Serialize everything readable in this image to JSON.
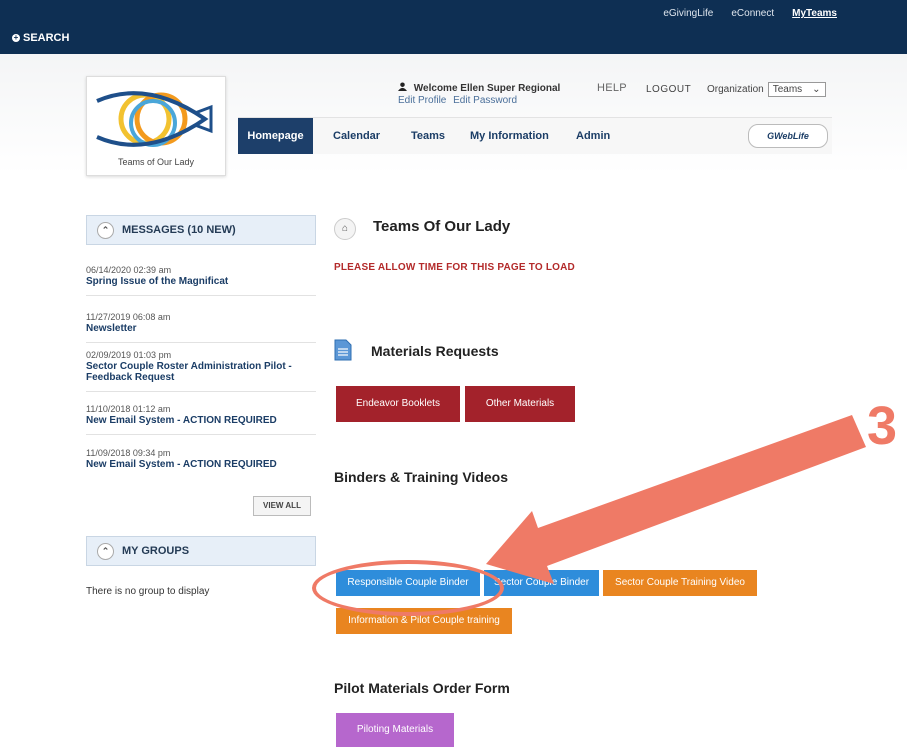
{
  "top_links": [
    "eGivingLife",
    "eConnect",
    "MyTeams"
  ],
  "search_label": "SEARCH",
  "logo_text": "Teams of Our Lady",
  "welcome": "Welcome Ellen Super Regional",
  "edit_profile": "Edit Profile",
  "edit_password": "Edit Password",
  "help": "HELP",
  "logout": "LOGOUT",
  "org_label": "Organization",
  "org_value": "Teams",
  "nav": [
    "Homepage",
    "Calendar",
    "Teams",
    "My Information",
    "Admin"
  ],
  "gweblife": "GWebLife",
  "messages_header": "MESSAGES (10 NEW)",
  "messages": [
    {
      "date": "06/14/2020 02:39 am",
      "title": "Spring Issue of the Magnificat"
    },
    {
      "date": "11/27/2019 06:08 am",
      "title": "Newsletter"
    },
    {
      "date": "02/09/2019 01:03 pm",
      "title": "Sector Couple Roster Administration Pilot - Feedback Request"
    },
    {
      "date": "11/10/2018 01:12 am",
      "title": "New Email System - ACTION REQUIRED"
    },
    {
      "date": "11/09/2018 09:34 pm",
      "title": "New Email System - ACTION REQUIRED"
    }
  ],
  "view_all": "VIEW ALL",
  "groups_header": "MY GROUPS",
  "no_group": "There is no group to display",
  "page_title": "Teams Of Our Lady",
  "notice": "PLEASE ALLOW TIME FOR THIS PAGE TO LOAD",
  "materials_title": "Materials Requests",
  "materials_buttons": [
    "Endeavor Booklets",
    "Other Materials"
  ],
  "binders_title": "Binders & Training Videos",
  "binder_buttons": [
    "Responsible Couple Binder",
    "Sector Couple Binder",
    "Sector Couple Training Video",
    "Information & Pilot Couple training"
  ],
  "pilot_title": "Pilot Materials Order Form",
  "pilot_button": "Piloting Materials",
  "annotation_number": "3",
  "colors": {
    "annotation": "#ef7a66",
    "navy": "#0e2f53",
    "red_button": "#a3222b",
    "blue_button": "#2e8ddb",
    "orange_button": "#e98520",
    "purple_button": "#b667cd"
  }
}
